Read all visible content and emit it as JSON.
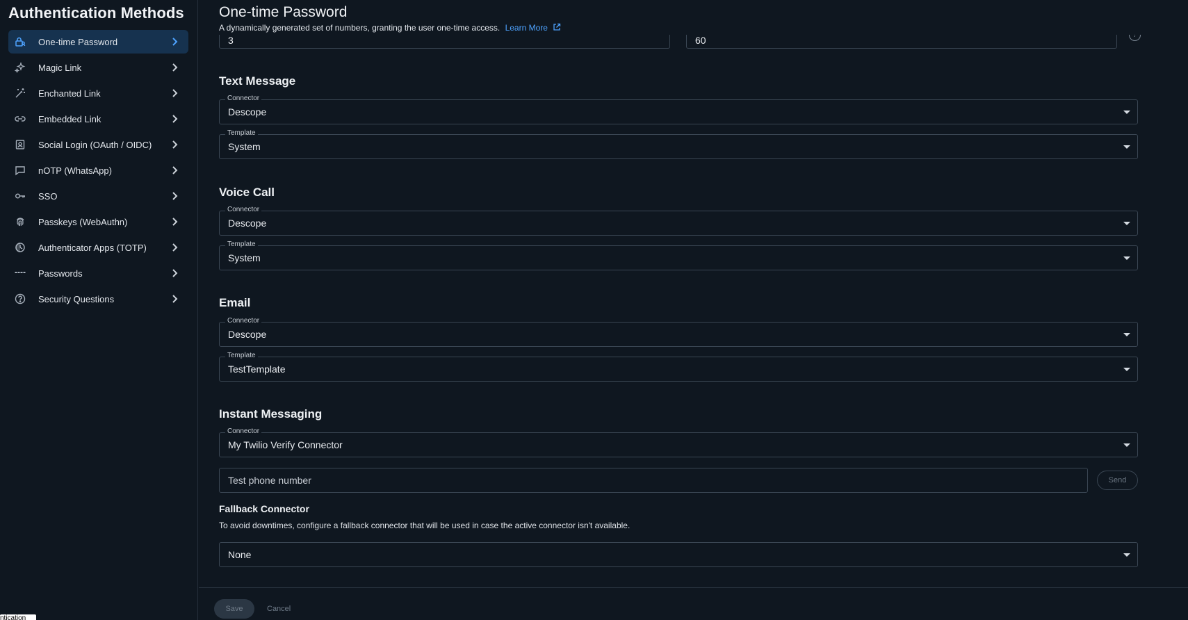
{
  "sidebar": {
    "title": "Authentication Methods",
    "items": [
      {
        "label": "One-time Password",
        "icon": "lock-user-icon"
      },
      {
        "label": "Magic Link",
        "icon": "sparkles-icon"
      },
      {
        "label": "Enchanted Link",
        "icon": "wand-icon"
      },
      {
        "label": "Embedded Link",
        "icon": "link-icon"
      },
      {
        "label": "Social Login (OAuth / OIDC)",
        "icon": "id-badge-icon"
      },
      {
        "label": "nOTP (WhatsApp)",
        "icon": "chat-bubble-icon"
      },
      {
        "label": "SSO",
        "icon": "key-icon"
      },
      {
        "label": "Passkeys (WebAuthn)",
        "icon": "fingerprint-icon"
      },
      {
        "label": "Authenticator Apps (TOTP)",
        "icon": "authenticator-icon"
      },
      {
        "label": "Passwords",
        "icon": "dots-icon"
      },
      {
        "label": "Security Questions",
        "icon": "question-circle-icon"
      }
    ],
    "active_index": 0
  },
  "tooltip_fragment": "ntication",
  "header": {
    "title": "One-time Password",
    "description": "A dynamically generated set of numbers, granting the user one-time access.",
    "learn_more": "Learn More"
  },
  "top_fields": {
    "left_value": "3",
    "right_value": "60"
  },
  "text_message": {
    "title": "Text Message",
    "connector_label": "Connector",
    "connector_value": "Descope",
    "template_label": "Template",
    "template_value": "System"
  },
  "voice_call": {
    "title": "Voice Call",
    "connector_label": "Connector",
    "connector_value": "Descope",
    "template_label": "Template",
    "template_value": "System"
  },
  "email": {
    "title": "Email",
    "connector_label": "Connector",
    "connector_value": "Descope",
    "template_label": "Template",
    "template_value": "TestTemplate"
  },
  "instant_messaging": {
    "title": "Instant Messaging",
    "connector_label": "Connector",
    "connector_value": "My Twilio Verify Connector",
    "test_phone_placeholder": "Test phone number",
    "send_label": "Send"
  },
  "fallback": {
    "title": "Fallback Connector",
    "description": "To avoid downtimes, configure a fallback connector that will be used in case the active connector isn't available.",
    "value": "None"
  },
  "footer": {
    "save_label": "Save",
    "cancel_label": "Cancel"
  }
}
